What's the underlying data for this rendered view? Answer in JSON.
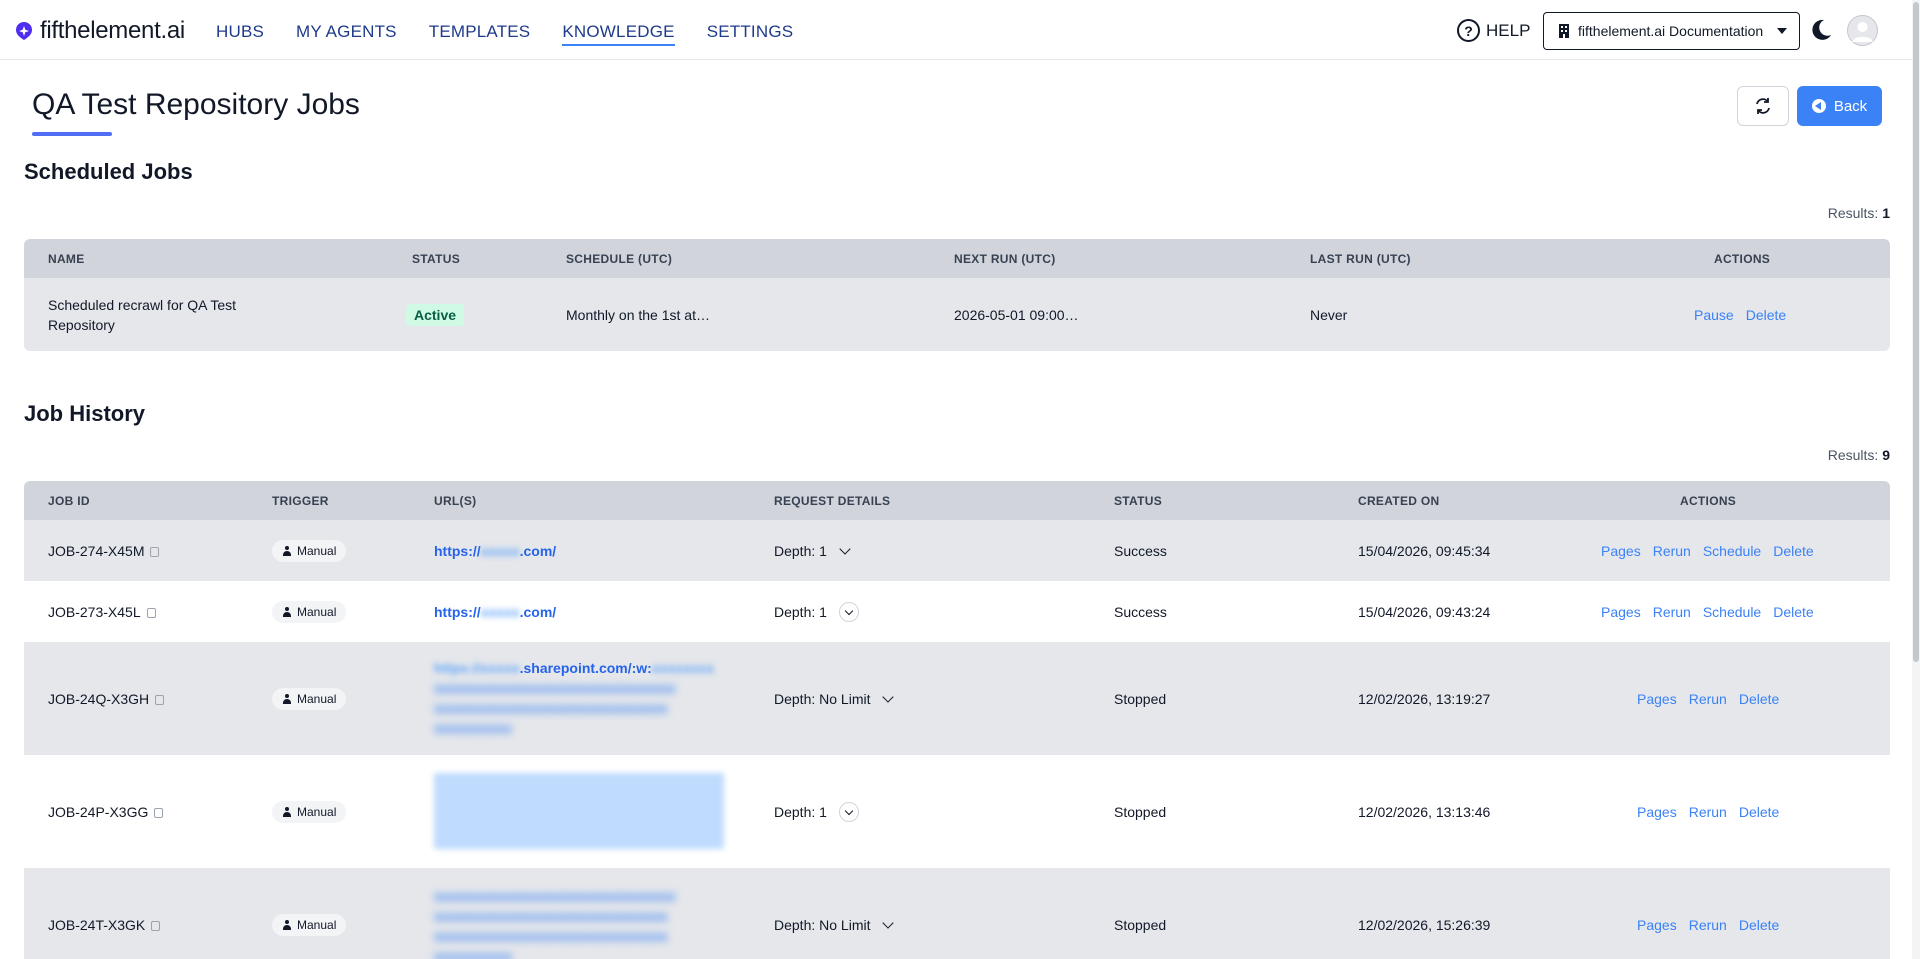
{
  "brand": {
    "name": "fifthelement.ai",
    "accent": "#4f2cf0"
  },
  "nav": {
    "items": [
      {
        "label": "HUBS"
      },
      {
        "label": "MY AGENTS"
      },
      {
        "label": "TEMPLATES"
      },
      {
        "label": "KNOWLEDGE",
        "active": true
      },
      {
        "label": "SETTINGS"
      }
    ],
    "help_label": "HELP",
    "workspace_label": "fifthelement.ai Documentation"
  },
  "page": {
    "title": "QA Test Repository Jobs",
    "back_label": "Back"
  },
  "scheduled": {
    "title": "Scheduled Jobs",
    "results_label": "Results:",
    "results_count": "1",
    "headers": [
      "NAME",
      "STATUS",
      "SCHEDULE (UTC)",
      "NEXT RUN (UTC)",
      "LAST RUN (UTC)",
      "ACTIONS"
    ],
    "rows": [
      {
        "name": "Scheduled recrawl for QA Test Repository",
        "status": "Active",
        "schedule": "Monthly on the 1st at…",
        "next_run": "2026-05-01 09:00…",
        "last_run": "Never",
        "actions": [
          "Pause",
          "Delete"
        ]
      }
    ]
  },
  "history": {
    "title": "Job History",
    "results_label": "Results:",
    "results_count": "9",
    "headers": [
      "JOB ID",
      "TRIGGER",
      "URL(S)",
      "REQUEST DETAILS",
      "STATUS",
      "CREATED ON",
      "ACTIONS"
    ],
    "rows": [
      {
        "job_id": "JOB-274-X45M",
        "trigger": "Manual",
        "url_prefix": "https://",
        "url_suffix": ".com/",
        "depth": "Depth: 1",
        "status": "Success",
        "created": "15/04/2026, 09:45:34",
        "actions": [
          "Pages",
          "Rerun",
          "Schedule",
          "Delete"
        ]
      },
      {
        "job_id": "JOB-273-X45L",
        "trigger": "Manual",
        "url_prefix": "https://",
        "url_suffix": ".com/",
        "depth": "Depth: 1",
        "status": "Success",
        "created": "15/04/2026, 09:43:24",
        "actions": [
          "Pages",
          "Rerun",
          "Schedule",
          "Delete"
        ]
      },
      {
        "job_id": "JOB-24Q-X3GH",
        "trigger": "Manual",
        "url_visible": ".sharepoint.com/:w:",
        "depth": "Depth: No Limit",
        "status": "Stopped",
        "created": "12/02/2026, 13:19:27",
        "actions": [
          "Pages",
          "Rerun",
          "Delete"
        ]
      },
      {
        "job_id": "JOB-24P-X3GG",
        "trigger": "Manual",
        "depth": "Depth: 1",
        "status": "Stopped",
        "created": "12/02/2026, 13:13:46",
        "actions": [
          "Pages",
          "Rerun",
          "Delete"
        ]
      },
      {
        "job_id": "JOB-24T-X3GK",
        "trigger": "Manual",
        "depth": "Depth: No Limit",
        "status": "Stopped",
        "created": "12/02/2026, 15:26:39",
        "actions": [
          "Pages",
          "Rerun",
          "Delete"
        ]
      }
    ]
  }
}
